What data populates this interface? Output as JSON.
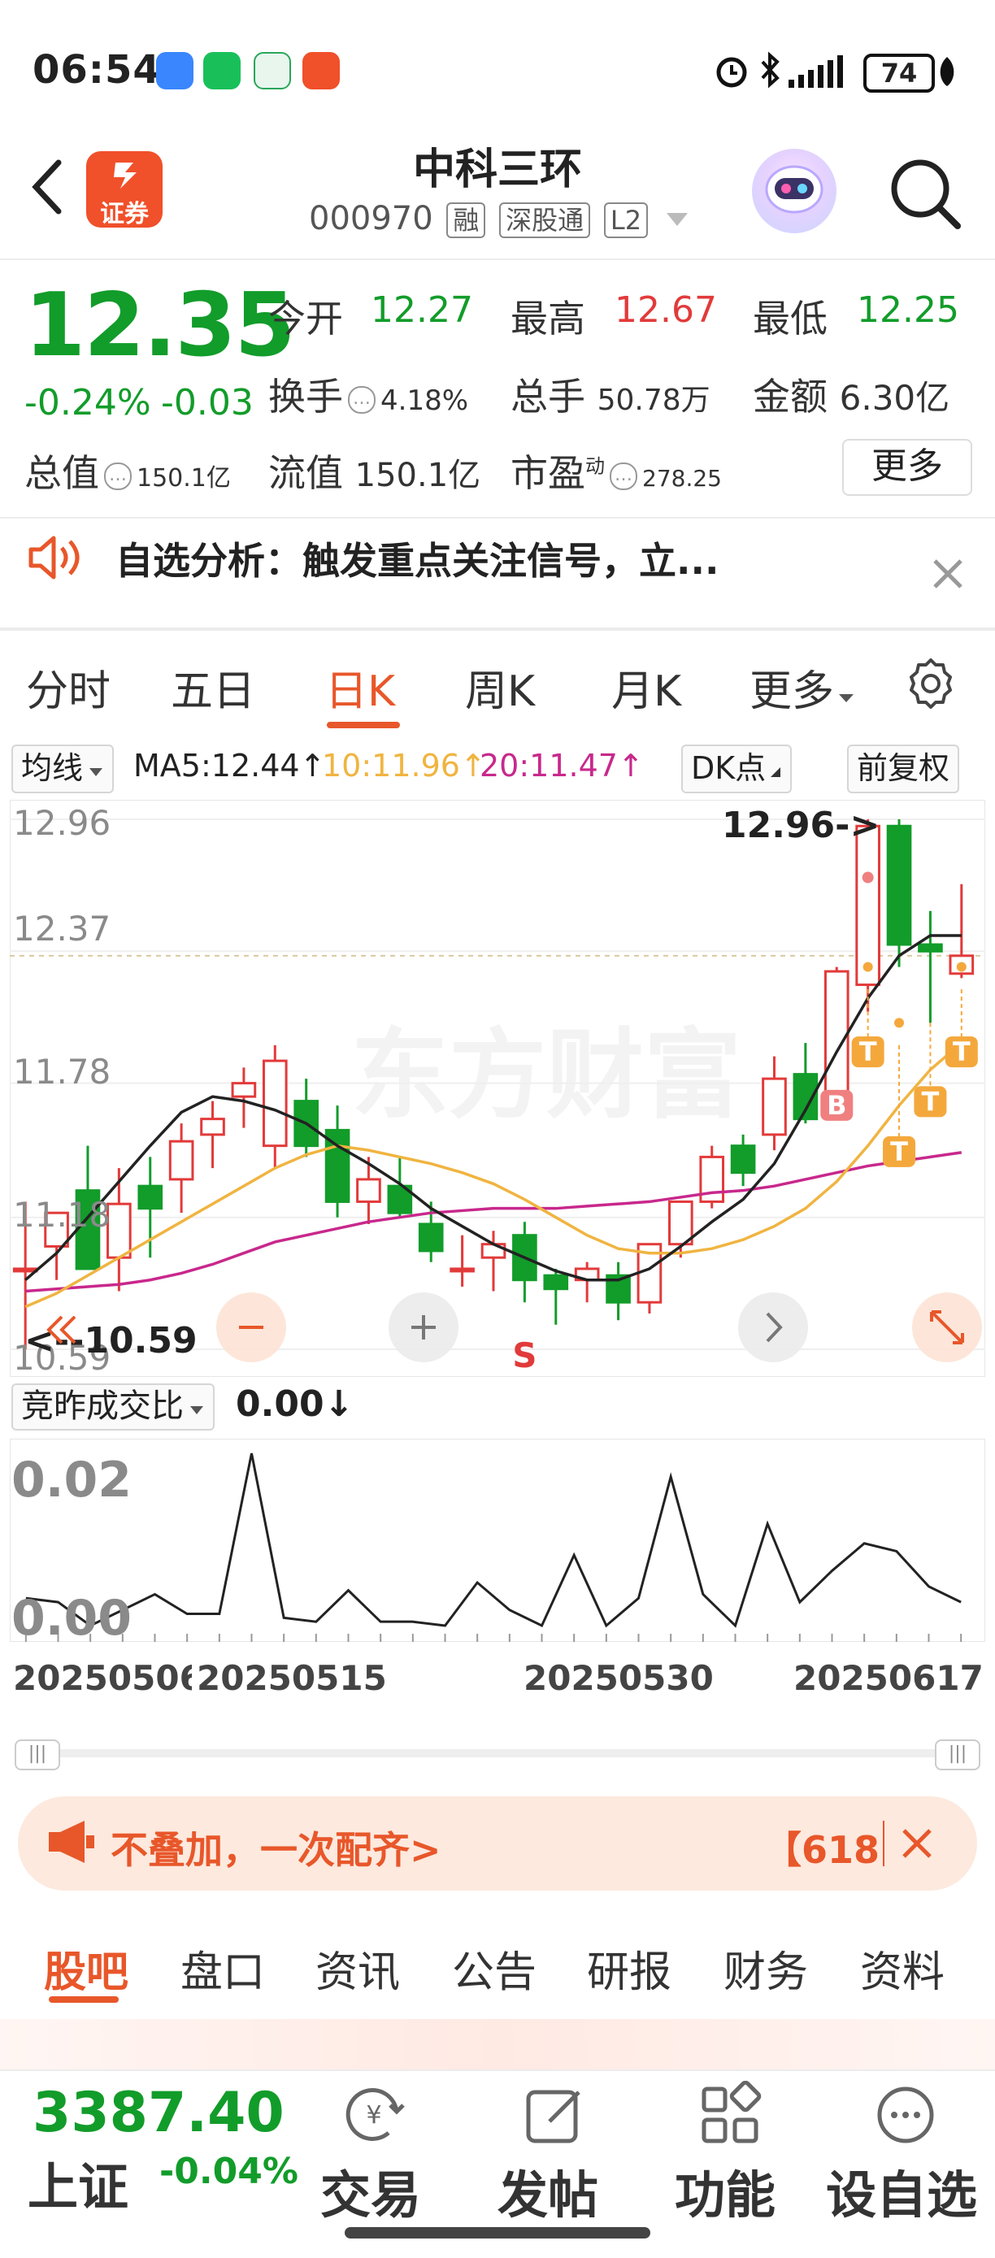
{
  "status_bar": {
    "time": "06:54",
    "battery": "74"
  },
  "header": {
    "logo_text": "证券",
    "title": "中科三环",
    "code": "000970",
    "tags": [
      "融",
      "深股通",
      "L2"
    ]
  },
  "quote": {
    "price": "12.35",
    "change_pct": "-0.24%",
    "change": "-0.03",
    "open_label": "今开",
    "open": "12.27",
    "high_label": "最高",
    "high": "12.67",
    "low_label": "最低",
    "low": "12.25",
    "turnover_label": "换手",
    "turnover": "4.18%",
    "volume_label": "总手",
    "volume": "50.78万",
    "amount_label": "金额",
    "amount": "6.30亿",
    "mktcap_label": "总值",
    "mktcap": "150.1亿",
    "float_label": "流值",
    "float": "150.1亿",
    "pe_label": "市盈",
    "pe_sup": "动",
    "pe": "278.25",
    "more_label": "更多"
  },
  "alert": {
    "text": "自选分析：触发重点关注信号，立..."
  },
  "tabs": {
    "items": [
      "分时",
      "五日",
      "日K",
      "周K",
      "月K",
      "更多"
    ],
    "active": "日K"
  },
  "chart_toolbar": {
    "ma_select": "均线",
    "ma5": "MA5:12.44↑",
    "ma10": "10:11.96↑",
    "ma20": "20:11.47↑",
    "dk_button": "DK点",
    "adjust_button": "前复权"
  },
  "colors": {
    "up": "#e23a3a",
    "down": "#129c2a",
    "accent": "#e8572a",
    "ma5": "#222222",
    "ma10": "#f0b440",
    "ma20": "#c8288c"
  },
  "chart_data": {
    "type": "candlestick",
    "y_ticks": [
      "12.96",
      "12.37",
      "11.78",
      "11.18",
      "10.59"
    ],
    "ylim": [
      10.59,
      12.96
    ],
    "max_annotation": "12.96->",
    "min_annotation": "<--10.59",
    "x_ticks": [
      "20250506",
      "20250515",
      "20250530",
      "20250617"
    ],
    "candles": [
      {
        "o": 10.95,
        "h": 11.25,
        "l": 10.59,
        "c": 10.95
      },
      {
        "o": 11.05,
        "h": 11.15,
        "l": 10.9,
        "c": 11.2
      },
      {
        "o": 11.3,
        "h": 11.5,
        "l": 10.95,
        "c": 10.95
      },
      {
        "o": 11.0,
        "h": 11.4,
        "l": 10.85,
        "c": 11.24
      },
      {
        "o": 11.32,
        "h": 11.45,
        "l": 11.0,
        "c": 11.22
      },
      {
        "o": 11.35,
        "h": 11.6,
        "l": 11.2,
        "c": 11.52
      },
      {
        "o": 11.55,
        "h": 11.7,
        "l": 11.4,
        "c": 11.62
      },
      {
        "o": 11.72,
        "h": 11.85,
        "l": 11.58,
        "c": 11.78
      },
      {
        "o": 11.5,
        "h": 11.95,
        "l": 11.4,
        "c": 11.88
      },
      {
        "o": 11.7,
        "h": 11.8,
        "l": 11.45,
        "c": 11.5
      },
      {
        "o": 11.57,
        "h": 11.68,
        "l": 11.18,
        "c": 11.25
      },
      {
        "o": 11.25,
        "h": 11.45,
        "l": 11.15,
        "c": 11.35
      },
      {
        "o": 11.32,
        "h": 11.45,
        "l": 11.18,
        "c": 11.2
      },
      {
        "o": 11.15,
        "h": 11.25,
        "l": 10.98,
        "c": 11.03
      },
      {
        "o": 10.95,
        "h": 11.1,
        "l": 10.87,
        "c": 10.95
      },
      {
        "o": 11.0,
        "h": 11.12,
        "l": 10.85,
        "c": 11.06
      },
      {
        "o": 11.1,
        "h": 11.16,
        "l": 10.8,
        "c": 10.9
      },
      {
        "o": 10.92,
        "h": 10.95,
        "l": 10.7,
        "c": 10.86
      },
      {
        "o": 10.9,
        "h": 10.98,
        "l": 10.8,
        "c": 10.95
      },
      {
        "o": 10.92,
        "h": 10.98,
        "l": 10.72,
        "c": 10.8
      },
      {
        "o": 10.8,
        "h": 11.06,
        "l": 10.75,
        "c": 11.06
      },
      {
        "o": 11.06,
        "h": 11.25,
        "l": 11.0,
        "c": 11.25
      },
      {
        "o": 11.25,
        "h": 11.5,
        "l": 11.22,
        "c": 11.45
      },
      {
        "o": 11.5,
        "h": 11.55,
        "l": 11.32,
        "c": 11.38
      },
      {
        "o": 11.55,
        "h": 11.9,
        "l": 11.48,
        "c": 11.8
      },
      {
        "o": 11.82,
        "h": 11.96,
        "l": 11.6,
        "c": 11.62
      },
      {
        "o": 11.72,
        "h": 12.3,
        "l": 11.68,
        "c": 12.28
      },
      {
        "o": 12.22,
        "h": 12.96,
        "l": 12.1,
        "c": 12.93
      },
      {
        "o": 12.93,
        "h": 12.96,
        "l": 12.3,
        "c": 12.4
      },
      {
        "o": 12.4,
        "h": 12.55,
        "l": 12.05,
        "c": 12.37
      },
      {
        "o": 12.27,
        "h": 12.67,
        "l": 12.25,
        "c": 12.35
      }
    ],
    "ma5": [
      10.9,
      11.02,
      11.18,
      11.34,
      11.5,
      11.65,
      11.72,
      11.7,
      11.66,
      11.6,
      11.5,
      11.42,
      11.33,
      11.22,
      11.14,
      11.06,
      11.0,
      10.94,
      10.9,
      10.9,
      10.95,
      11.05,
      11.16,
      11.26,
      11.42,
      11.66,
      11.92,
      12.16,
      12.35,
      12.44,
      12.44
    ],
    "ma10": [
      10.78,
      10.84,
      10.92,
      11.0,
      11.08,
      11.16,
      11.24,
      11.32,
      11.4,
      11.46,
      11.5,
      11.48,
      11.45,
      11.42,
      11.38,
      11.33,
      11.26,
      11.18,
      11.1,
      11.04,
      11.02,
      11.02,
      11.04,
      11.08,
      11.14,
      11.22,
      11.34,
      11.5,
      11.68,
      11.84,
      11.96
    ],
    "ma20": [
      10.85,
      10.86,
      10.87,
      10.88,
      10.9,
      10.93,
      10.97,
      11.02,
      11.07,
      11.1,
      11.13,
      11.16,
      11.18,
      11.2,
      11.21,
      11.22,
      11.22,
      11.22,
      11.23,
      11.24,
      11.25,
      11.27,
      11.29,
      11.3,
      11.32,
      11.35,
      11.38,
      11.41,
      11.43,
      11.45,
      11.47
    ],
    "markers": [
      "B",
      "T",
      "T",
      "T",
      "T",
      "S"
    ]
  },
  "indicator": {
    "select": "竞昨成交比",
    "value": "0.00↓",
    "y_ticks": [
      "0.02",
      "0.00"
    ],
    "values": [
      0.0014,
      0.0012,
      0.0,
      0.0008,
      0.0016,
      0.0006,
      0.0006,
      0.0088,
      0.0004,
      0.0002,
      0.0018,
      0.0002,
      0.0002,
      0.0,
      0.0022,
      0.0008,
      0.0,
      0.0036,
      0.0,
      0.0014,
      0.0076,
      0.0016,
      0.0,
      0.0052,
      0.0012,
      0.0028,
      0.0042,
      0.0038,
      0.002,
      0.0012
    ]
  },
  "ad": {
    "text": "不叠加，一次配齐>",
    "right": "【618"
  },
  "bottom_tabs": {
    "items": [
      "股吧",
      "盘口",
      "资讯",
      "公告",
      "研报",
      "财务",
      "资料"
    ],
    "active": "股吧"
  },
  "bottom_nav": {
    "index_value": "3387.40",
    "index_name": "上证",
    "index_change": "-0.04%",
    "items": [
      "交易",
      "发帖",
      "功能",
      "设自选"
    ]
  }
}
